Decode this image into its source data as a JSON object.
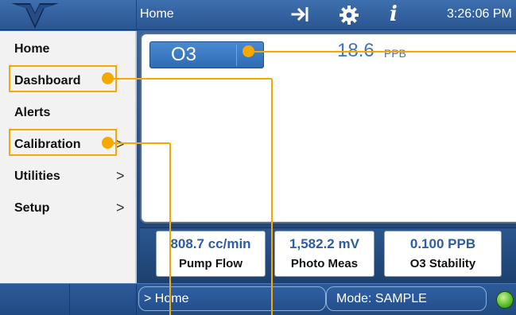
{
  "header": {
    "title": "Home",
    "clock": "3:26:06 PM",
    "info_glyph": "i",
    "icons": [
      "logo-icon",
      "exit-icon",
      "gear-icon",
      "info-icon"
    ]
  },
  "sidebar": {
    "items": [
      {
        "label": "Home",
        "has_submenu": false,
        "highlighted": false
      },
      {
        "label": "Dashboard",
        "has_submenu": false,
        "highlighted": true
      },
      {
        "label": "Alerts",
        "has_submenu": false,
        "highlighted": false
      },
      {
        "label": "Calibration",
        "has_submenu": true,
        "highlighted": true
      },
      {
        "label": "Utilities",
        "has_submenu": true,
        "highlighted": false
      },
      {
        "label": "Setup",
        "has_submenu": true,
        "highlighted": false
      }
    ],
    "chevron": ">"
  },
  "main": {
    "gas": {
      "name": "O3",
      "value": "18.6",
      "unit": "PPB"
    }
  },
  "stats": [
    {
      "value": "808.7 cc/min",
      "label": "Pump Flow"
    },
    {
      "value": "1,582.2 mV",
      "label": "Photo Meas"
    },
    {
      "value": "0.100 PPB",
      "label": "O3 Stability"
    }
  ],
  "footer": {
    "breadcrumb": "> Home",
    "mode": "Mode: SAMPLE",
    "status": "green"
  },
  "colors": {
    "accent": "#f5a800",
    "header_blue": "#2b5592",
    "value_blue": "#3a77c2",
    "status_green": "#5cbf2a"
  }
}
